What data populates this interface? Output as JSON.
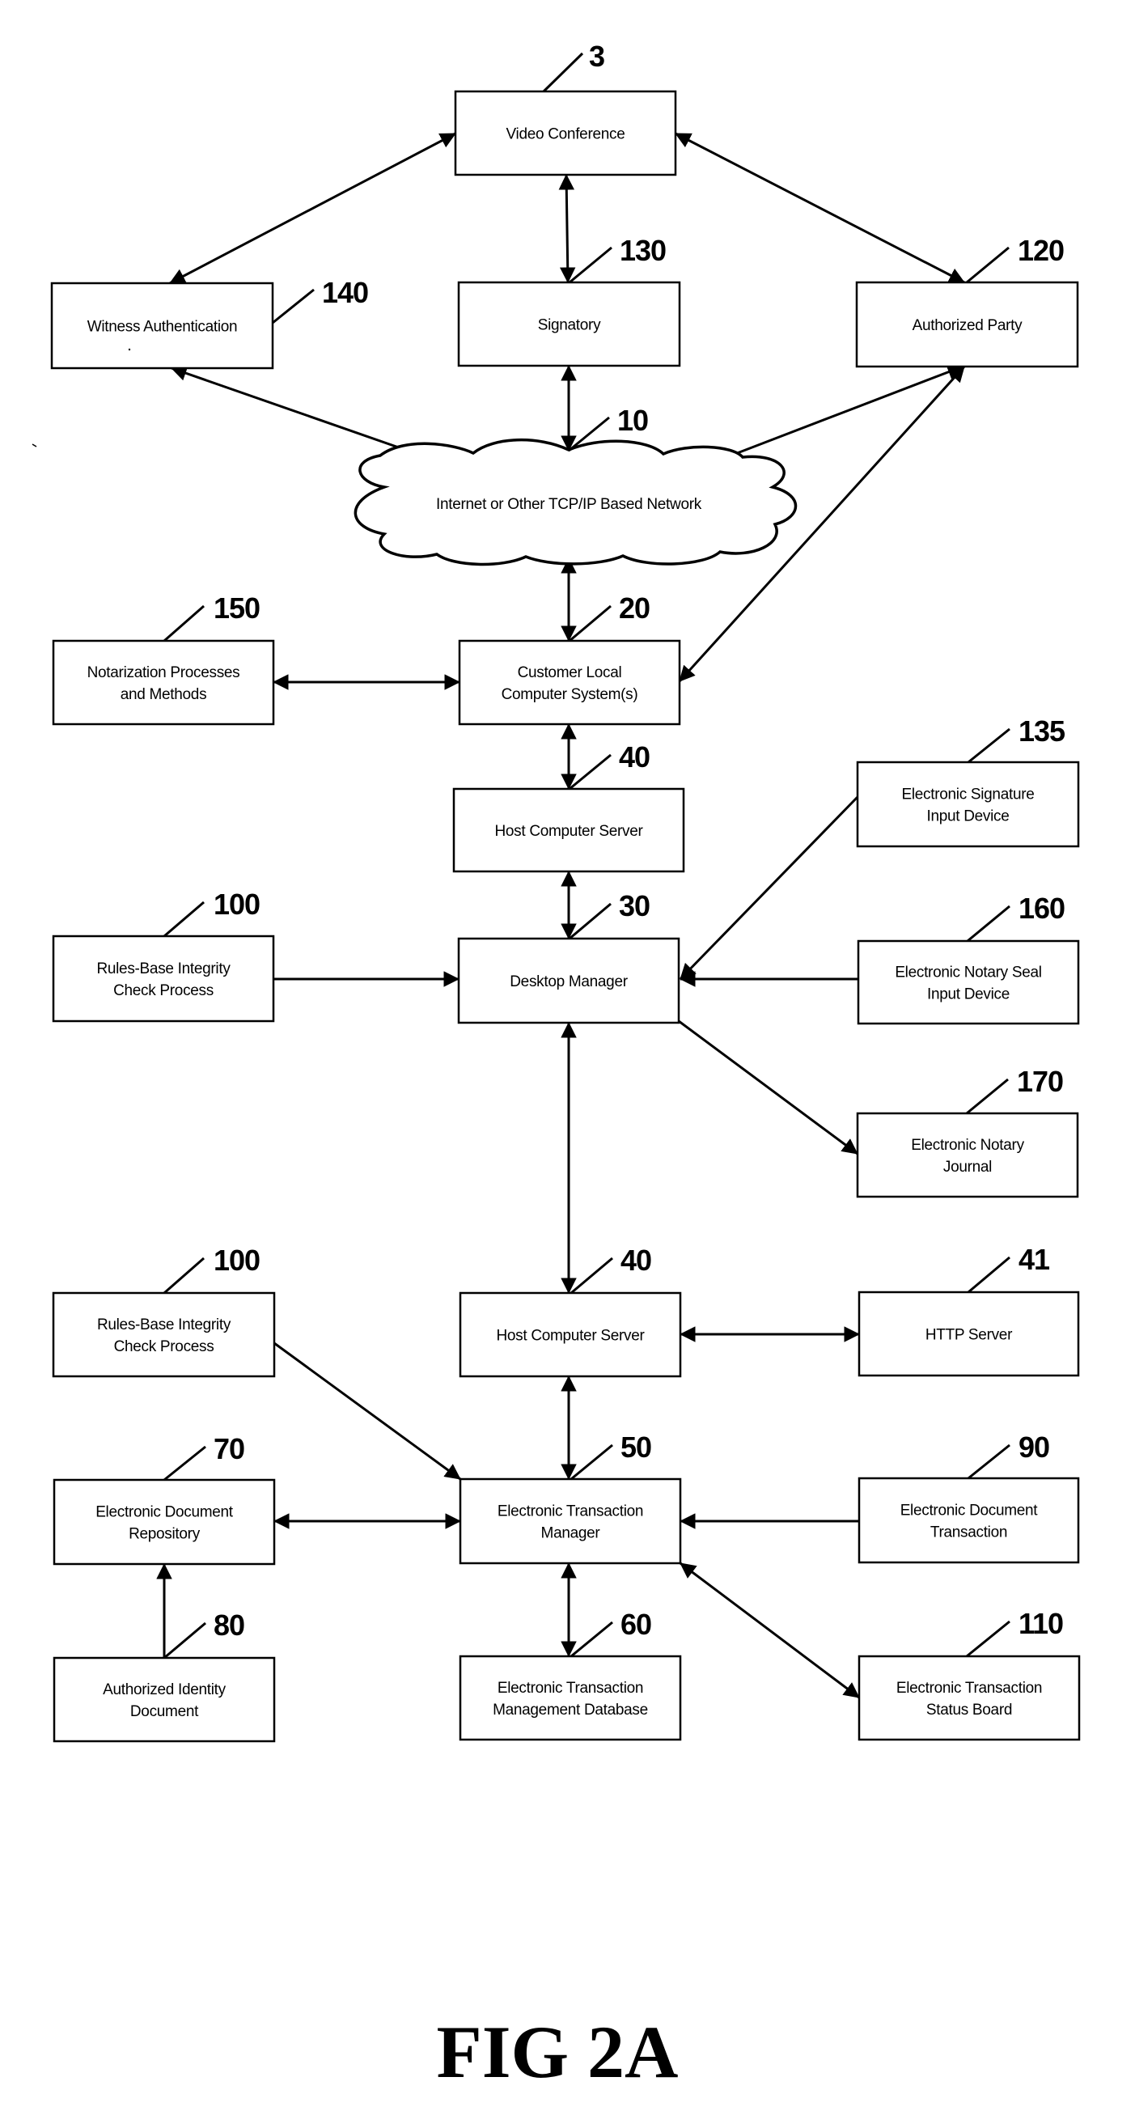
{
  "figure": {
    "title": "FIG 2A",
    "type": "block-diagram"
  },
  "nodes": [
    {
      "id": "video_conference",
      "ref": "3",
      "lines": [
        "Video Conference"
      ]
    },
    {
      "id": "witness_authentication",
      "ref": "140",
      "lines": [
        "Witness Authentication"
      ]
    },
    {
      "id": "signatory",
      "ref": "130",
      "lines": [
        "Signatory"
      ]
    },
    {
      "id": "authorized_party",
      "ref": "120",
      "lines": [
        "Authorized Party"
      ]
    },
    {
      "id": "network",
      "ref": "10",
      "lines": [
        "Internet or Other TCP/IP Based Network"
      ],
      "shape": "cloud"
    },
    {
      "id": "notarization_processes",
      "ref": "150",
      "lines": [
        "Notarization Processes",
        "and Methods"
      ]
    },
    {
      "id": "customer_local",
      "ref": "20",
      "lines": [
        "Customer Local",
        "Computer System(s)"
      ]
    },
    {
      "id": "host_server_1",
      "ref": "40",
      "lines": [
        "Host Computer Server"
      ]
    },
    {
      "id": "esig_input_device",
      "ref": "135",
      "lines": [
        "Electronic Signature",
        "Input Device"
      ]
    },
    {
      "id": "rules_integrity_1",
      "ref": "100",
      "lines": [
        "Rules-Base Integrity",
        "Check Process"
      ]
    },
    {
      "id": "desktop_manager",
      "ref": "30",
      "lines": [
        "Desktop Manager"
      ]
    },
    {
      "id": "notary_seal_device",
      "ref": "160",
      "lines": [
        "Electronic Notary Seal",
        "Input Device"
      ]
    },
    {
      "id": "notary_journal",
      "ref": "170",
      "lines": [
        "Electronic Notary",
        "Journal"
      ]
    },
    {
      "id": "rules_integrity_2",
      "ref": "100",
      "lines": [
        "Rules-Base Integrity",
        "Check Process"
      ]
    },
    {
      "id": "host_server_2",
      "ref": "40",
      "lines": [
        "Host Computer Server"
      ]
    },
    {
      "id": "http_server",
      "ref": "41",
      "lines": [
        "HTTP Server"
      ]
    },
    {
      "id": "doc_repository",
      "ref": "70",
      "lines": [
        "Electronic Document",
        "Repository"
      ]
    },
    {
      "id": "transaction_manager",
      "ref": "50",
      "lines": [
        "Electronic Transaction",
        "Manager"
      ]
    },
    {
      "id": "doc_transaction",
      "ref": "90",
      "lines": [
        "Electronic Document",
        "Transaction"
      ]
    },
    {
      "id": "identity_document",
      "ref": "80",
      "lines": [
        "Authorized Identity",
        "Document"
      ]
    },
    {
      "id": "transaction_db",
      "ref": "60",
      "lines": [
        "Electronic Transaction",
        "Management Database"
      ]
    },
    {
      "id": "status_board",
      "ref": "110",
      "lines": [
        "Electronic Transaction",
        "Status Board"
      ]
    }
  ],
  "edges": [
    {
      "from": "video_conference",
      "to": "witness_authentication",
      "direction": "both"
    },
    {
      "from": "video_conference",
      "to": "signatory",
      "direction": "both"
    },
    {
      "from": "video_conference",
      "to": "authorized_party",
      "direction": "both"
    },
    {
      "from": "witness_authentication",
      "to": "network",
      "direction": "both"
    },
    {
      "from": "signatory",
      "to": "network",
      "direction": "both"
    },
    {
      "from": "authorized_party",
      "to": "network",
      "direction": "both"
    },
    {
      "from": "authorized_party",
      "to": "customer_local",
      "direction": "both"
    },
    {
      "from": "network",
      "to": "customer_local",
      "direction": "both"
    },
    {
      "from": "notarization_processes",
      "to": "customer_local",
      "direction": "both"
    },
    {
      "from": "customer_local",
      "to": "host_server_1",
      "direction": "both"
    },
    {
      "from": "host_server_1",
      "to": "desktop_manager",
      "direction": "both"
    },
    {
      "from": "rules_integrity_1",
      "to": "desktop_manager",
      "direction": "forward"
    },
    {
      "from": "esig_input_device",
      "to": "desktop_manager",
      "direction": "forward"
    },
    {
      "from": "notary_seal_device",
      "to": "desktop_manager",
      "direction": "forward"
    },
    {
      "from": "desktop_manager",
      "to": "notary_journal",
      "direction": "forward"
    },
    {
      "from": "desktop_manager",
      "to": "host_server_2",
      "direction": "both"
    },
    {
      "from": "host_server_2",
      "to": "http_server",
      "direction": "both"
    },
    {
      "from": "host_server_2",
      "to": "transaction_manager",
      "direction": "both"
    },
    {
      "from": "rules_integrity_2",
      "to": "transaction_manager",
      "direction": "forward"
    },
    {
      "from": "doc_repository",
      "to": "transaction_manager",
      "direction": "both"
    },
    {
      "from": "doc_transaction",
      "to": "transaction_manager",
      "direction": "forward"
    },
    {
      "from": "identity_document",
      "to": "doc_repository",
      "direction": "forward"
    },
    {
      "from": "transaction_manager",
      "to": "transaction_db",
      "direction": "both"
    },
    {
      "from": "transaction_manager",
      "to": "status_board",
      "direction": "both"
    }
  ]
}
